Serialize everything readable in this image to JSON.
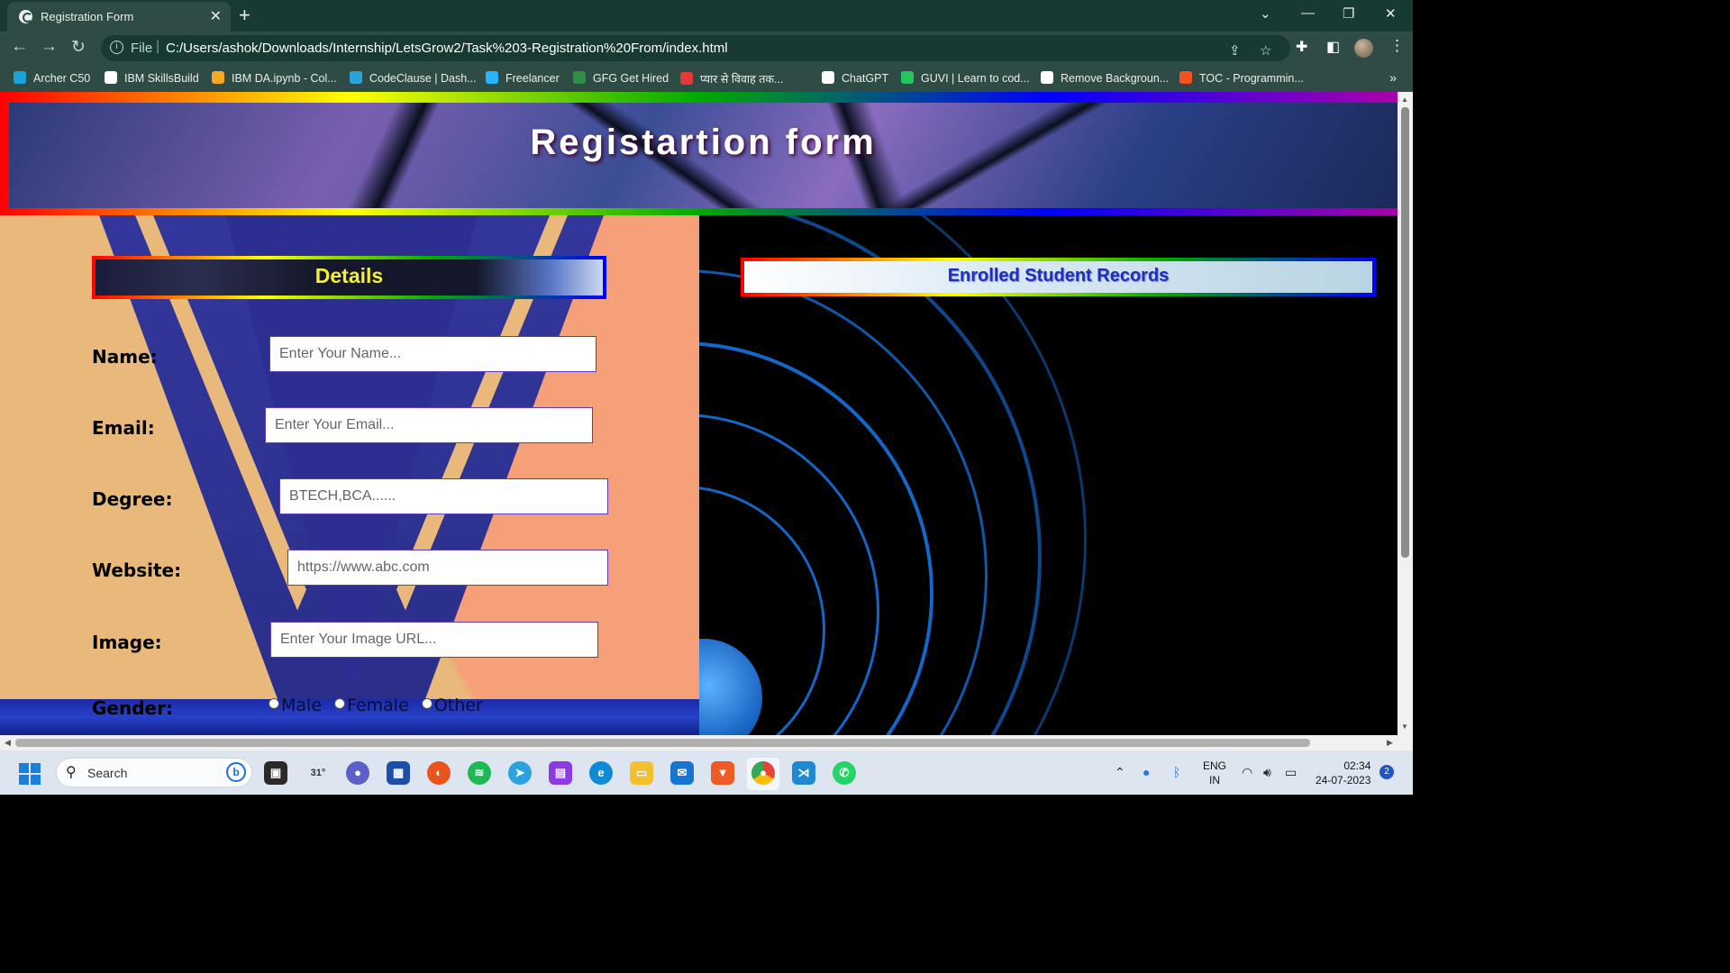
{
  "browser": {
    "tab_title": "Registration Form",
    "tab_close": "✕",
    "new_tab": "+",
    "url_scheme": "File",
    "url": "C:/Users/ashok/Downloads/Internship/LetsGrow2/Task%203-Registration%20From/index.html",
    "bookmarks": [
      {
        "label": "Archer C50",
        "color": "#19a4d8"
      },
      {
        "label": "IBM SkillsBuild",
        "color": "#ffffff"
      },
      {
        "label": "IBM DA.ipynb - Col...",
        "color": "#f9a825"
      },
      {
        "label": "CodeClause | Dash...",
        "color": "#2aa3d8"
      },
      {
        "label": "Freelancer",
        "color": "#29b2fe"
      },
      {
        "label": "GFG Get Hired",
        "color": "#2f8d46"
      },
      {
        "label": "प्यार से विवाह तक...",
        "color": "#e53935"
      },
      {
        "label": "ChatGPT",
        "color": "#ffffff"
      },
      {
        "label": "GUVI | Learn to cod...",
        "color": "#22c55e"
      },
      {
        "label": "Remove Backgroun...",
        "color": "#ffffff"
      },
      {
        "label": "TOC - Programmin...",
        "color": "#f4511e"
      }
    ],
    "more_bookmarks": "»"
  },
  "page": {
    "header_title": "Registartion form",
    "details_title": "Details",
    "records_title": "Enrolled Student Records",
    "fields": {
      "name": {
        "label": "Name:",
        "placeholder": "Enter Your Name..."
      },
      "email": {
        "label": "Email:",
        "placeholder": "Enter Your Email..."
      },
      "degree": {
        "label": "Degree:",
        "placeholder": "BTECH,BCA......"
      },
      "website": {
        "label": "Website:",
        "placeholder": "https://www.abc.com"
      },
      "image": {
        "label": "Image:",
        "placeholder": "Enter Your Image URL..."
      },
      "gender": {
        "label": "Gender:",
        "options": [
          "Male",
          "Female",
          "Other"
        ]
      }
    }
  },
  "taskbar": {
    "search_text": "Search",
    "weather": "31°",
    "lang_line1": "ENG",
    "lang_line2": "IN",
    "time": "02:34",
    "date": "24-07-2023",
    "notifications": "2"
  }
}
